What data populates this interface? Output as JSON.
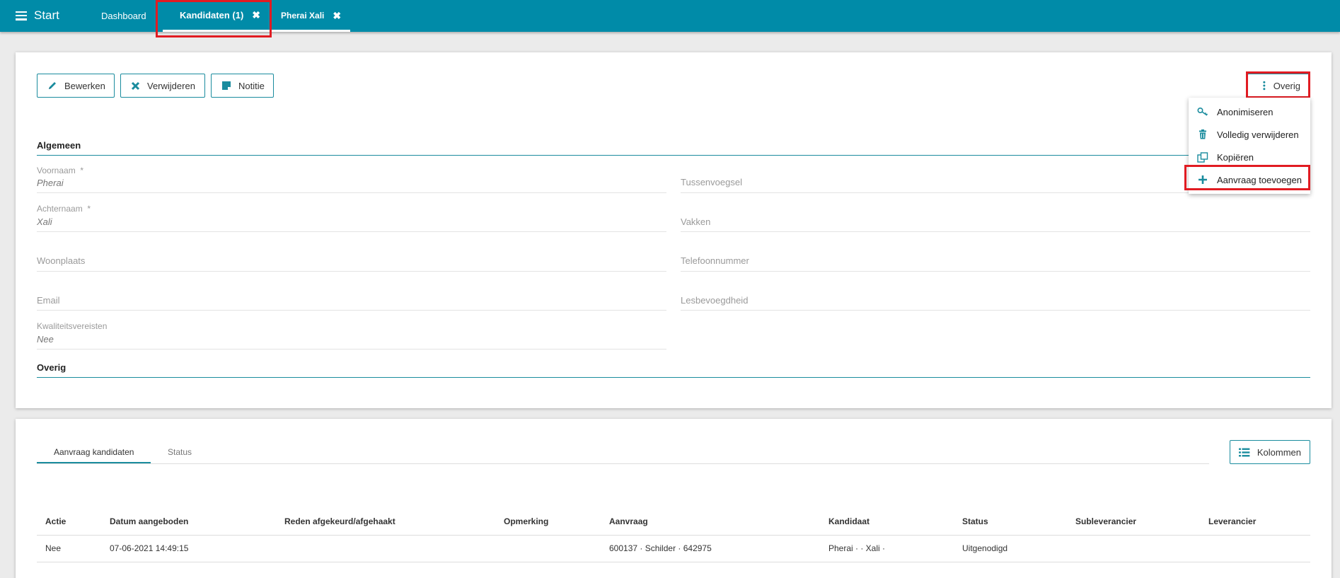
{
  "nav": {
    "start": "Start",
    "tabs": [
      {
        "label": "Dashboard"
      },
      {
        "label": "Kandidaten (1)",
        "close": "✖"
      },
      {
        "label": "Pherai Xali",
        "close": "✖"
      }
    ]
  },
  "toolbar": {
    "edit": "Bewerken",
    "delete": "Verwijderen",
    "note": "Notitie",
    "more": "Overig"
  },
  "menu": {
    "items": [
      {
        "label": "Anonimiseren",
        "icon": "key-icon"
      },
      {
        "label": "Volledig verwijderen",
        "icon": "trash-icon"
      },
      {
        "label": "Kopiëren",
        "icon": "copy-icon"
      },
      {
        "label": "Aanvraag toevoegen",
        "icon": "plus-icon"
      }
    ]
  },
  "form": {
    "section_general": "Algemeen",
    "section_other": "Overig",
    "required_mark": "*",
    "voornaam": {
      "label": "Voornaam",
      "value": "Pherai"
    },
    "tussenvoegsel": {
      "label": "Tussenvoegsel"
    },
    "achternaam": {
      "label": "Achternaam",
      "value": "Xali"
    },
    "vakken": {
      "label": "Vakken"
    },
    "woonplaats": {
      "label": "Woonplaats"
    },
    "telefoonnummer": {
      "label": "Telefoonnummer"
    },
    "email": {
      "label": "Email"
    },
    "lesbevoegdheid": {
      "label": "Lesbevoegdheid"
    },
    "kwaliteitsvereisten": {
      "label": "Kwaliteitsvereisten",
      "value": "Nee"
    }
  },
  "bottom": {
    "tabs": [
      "Aanvraag kandidaten",
      "Status"
    ],
    "columns_button": "Kolommen",
    "table": {
      "headers": [
        "Actie",
        "Datum aangeboden",
        "Reden afgekeurd/afgehaakt",
        "Opmerking",
        "Aanvraag",
        "Kandidaat",
        "Status",
        "Subleverancier",
        "Leverancier"
      ],
      "rows": [
        [
          "Nee",
          "07-06-2021 14:49:15",
          "",
          "",
          "600137 · Schilder · 642975",
          "Pherai · · Xali ·",
          "Uitgenodigd",
          "",
          ""
        ]
      ]
    }
  },
  "colors": {
    "topbar": "#008ba8",
    "accent": "#1a8c9e",
    "highlight": "#e11b22"
  }
}
